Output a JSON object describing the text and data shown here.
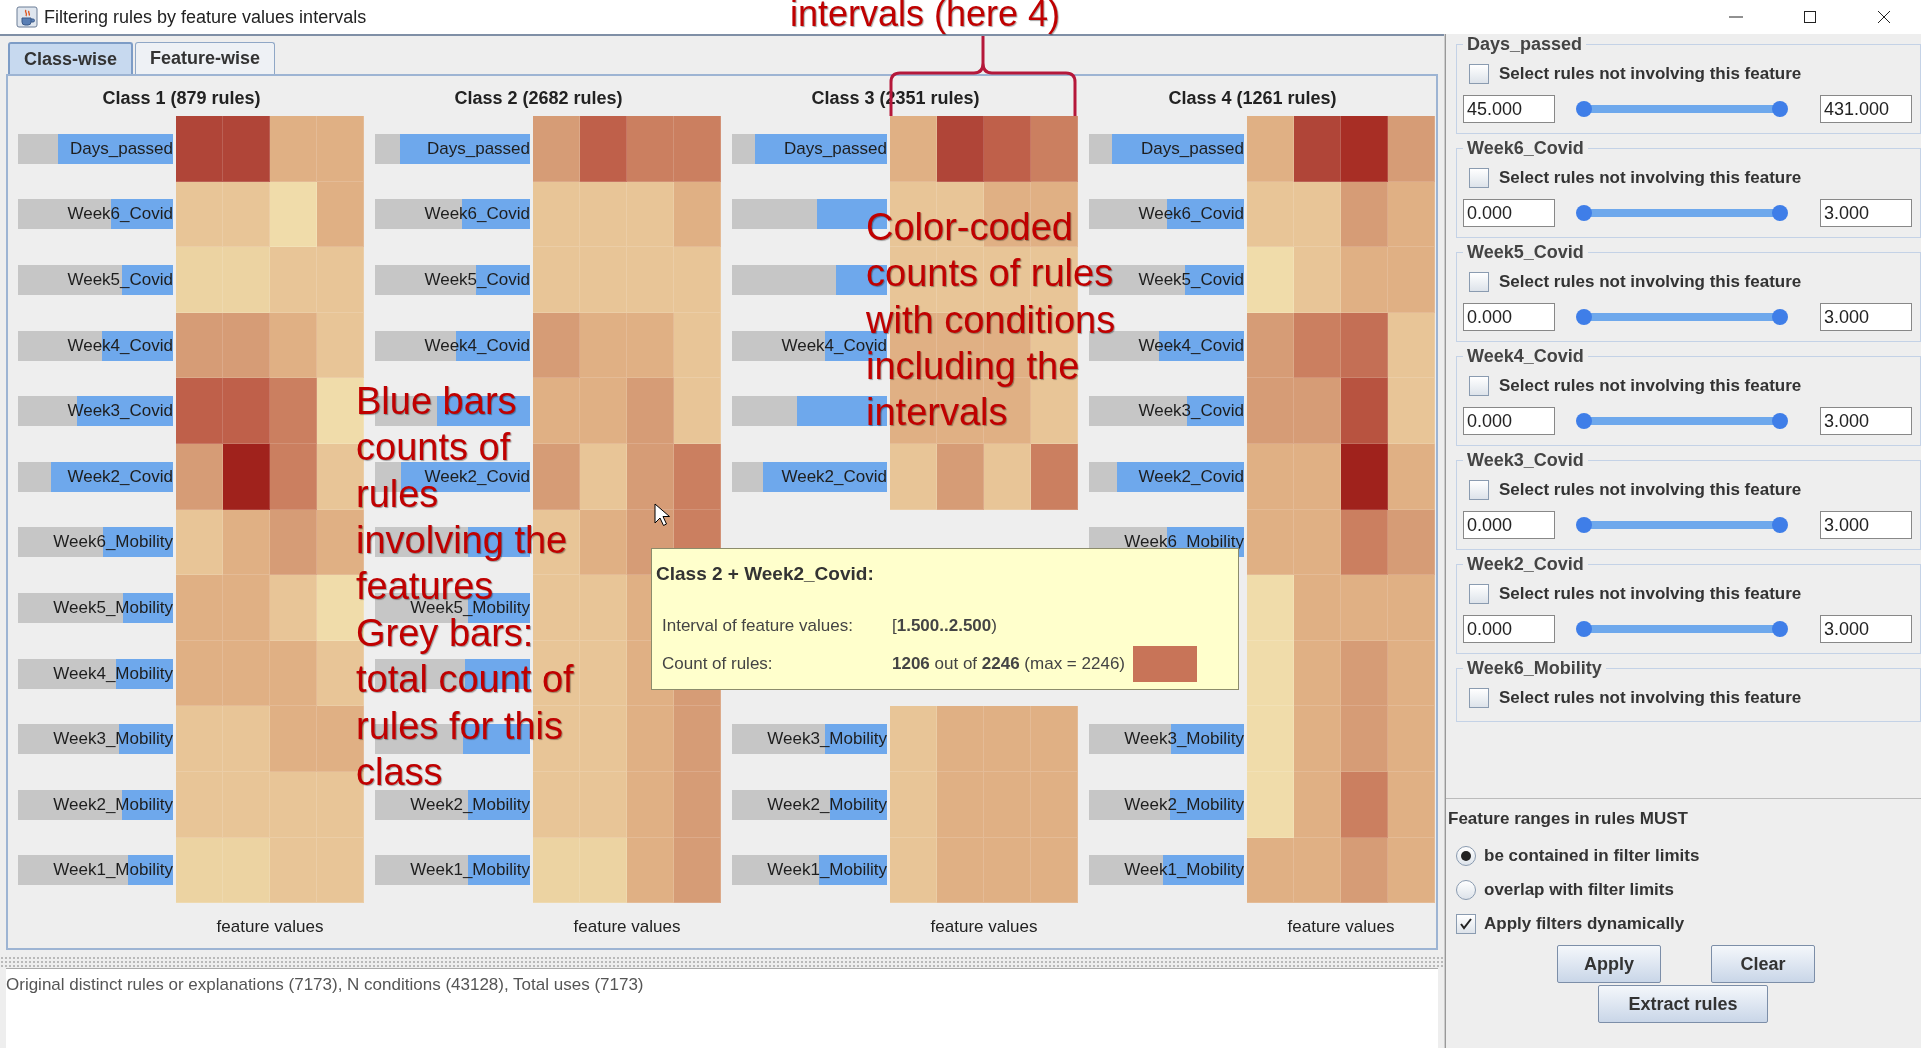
{
  "window": {
    "title": "Filtering rules by feature values intervals"
  },
  "tabs": [
    {
      "label": "Class-wise",
      "selected": true
    },
    {
      "label": "Feature-wise",
      "selected": false
    }
  ],
  "classes": [
    {
      "title": "Class 1 (879 rules)",
      "axis_label": "feature values",
      "rows": [
        {
          "label": "Days_passed",
          "level": 0.74,
          "cells": [
            {
              "color": "#b04538"
            },
            {
              "color": "#b04538"
            },
            {
              "color": "#e0b084"
            },
            {
              "color": "#e0b084"
            }
          ]
        },
        {
          "label": "Week6_Covid",
          "level": 0.4,
          "cells": [
            {
              "color": "#e8c597"
            },
            {
              "color": "#e8c597"
            },
            {
              "color": "#f0dcaa"
            },
            {
              "color": "#e0b084"
            }
          ]
        },
        {
          "label": "Week5_Covid",
          "level": 0.33,
          "cells": [
            {
              "color": "#ecd3a2"
            },
            {
              "color": "#ecd3a2"
            },
            {
              "color": "#e8c597"
            },
            {
              "color": "#e8c597"
            }
          ]
        },
        {
          "label": "Week4_Covid",
          "level": 0.46,
          "cells": [
            {
              "color": "#d69c76"
            },
            {
              "color": "#d69c76"
            },
            {
              "color": "#e0b084"
            },
            {
              "color": "#e8c597"
            }
          ]
        },
        {
          "label": "Week3_Covid",
          "level": 0.62,
          "cells": [
            {
              "color": "#bf604a"
            },
            {
              "color": "#bf604a"
            },
            {
              "color": "#cb7f60"
            },
            {
              "color": "#f0dcaa"
            }
          ]
        },
        {
          "label": "Week2_Covid",
          "level": 0.79,
          "cells": [
            {
              "color": "#d69c76"
            },
            {
              "color": "#a0221c"
            },
            {
              "color": "#cb7f60"
            },
            {
              "color": "#e8c597"
            }
          ]
        },
        {
          "label": "Week6_Mobility",
          "level": 0.45,
          "cells": [
            {
              "color": "#e8c597"
            },
            {
              "color": "#e0b084"
            },
            {
              "color": "#d69c76"
            },
            {
              "color": "#e0b084"
            }
          ]
        },
        {
          "label": "Week5_Mobility",
          "level": 0.32,
          "cells": [
            {
              "color": "#e0b084"
            },
            {
              "color": "#e0b084"
            },
            {
              "color": "#e8c597"
            },
            {
              "color": "#f0dcaa"
            }
          ]
        },
        {
          "label": "Week4_Mobility",
          "level": 0.37,
          "cells": [
            {
              "color": "#e0b084"
            },
            {
              "color": "#e0b084"
            },
            {
              "color": "#e0b084"
            },
            {
              "color": "#e8c597"
            }
          ]
        },
        {
          "label": "Week3_Mobility",
          "level": 0.35,
          "cells": [
            {
              "color": "#e8c597"
            },
            {
              "color": "#e8c597"
            },
            {
              "color": "#e0b084"
            },
            {
              "color": "#e0b084"
            }
          ]
        },
        {
          "label": "Week2_Mobility",
          "level": 0.33,
          "cells": [
            {
              "color": "#e8c597"
            },
            {
              "color": "#e8c597"
            },
            {
              "color": "#e8c597"
            },
            {
              "color": "#e8c597"
            }
          ]
        },
        {
          "label": "Week1_Mobility",
          "level": 0.29,
          "cells": [
            {
              "color": "#ecd3a2"
            },
            {
              "color": "#ecd3a2"
            },
            {
              "color": "#e8c597"
            },
            {
              "color": "#e8c597"
            }
          ]
        }
      ]
    },
    {
      "title": "Class 2 (2682 rules)",
      "axis_label": "feature values",
      "rows": [
        {
          "label": "Days_passed",
          "level": 0.84,
          "cells": [
            {
              "color": "#d69c76"
            },
            {
              "color": "#bf604a"
            },
            {
              "color": "#cb7f60"
            },
            {
              "color": "#cb7f60"
            }
          ]
        },
        {
          "label": "Week6_Covid",
          "level": 0.44,
          "cells": [
            {
              "color": "#e8c597"
            },
            {
              "color": "#e8c597"
            },
            {
              "color": "#e8c597"
            },
            {
              "color": "#e0b084"
            }
          ]
        },
        {
          "label": "Week5_Covid",
          "level": 0.35,
          "cells": [
            {
              "color": "#e8c597"
            },
            {
              "color": "#e8c597"
            },
            {
              "color": "#e8c597"
            },
            {
              "color": "#e8c597"
            }
          ]
        },
        {
          "label": "Week4_Covid",
          "level": 0.48,
          "cells": [
            {
              "color": "#d69c76"
            },
            {
              "color": "#e0b084"
            },
            {
              "color": "#e0b084"
            },
            {
              "color": "#e8c597"
            }
          ]
        },
        {
          "level": 0.6,
          "cells": [
            {
              "color": "#e0b084"
            },
            {
              "color": "#e0b084"
            },
            {
              "color": "#d69c76"
            },
            {
              "color": "#e8c597"
            }
          ]
        },
        {
          "label": "Week2_Covid",
          "level": 0.83,
          "cells": [
            {
              "color": "#d69c76"
            },
            {
              "color": "#e8c597"
            },
            {
              "color": "#d69c76"
            },
            {
              "color": "#cb7f60"
            }
          ]
        },
        {
          "level": 0.4,
          "cells": [
            {
              "color": "#e8c597"
            },
            {
              "color": "#e0b084"
            },
            {
              "color": "#d69c76"
            },
            {
              "color": "#cb7f60"
            }
          ]
        },
        {
          "label": "Week5_Mobility",
          "level": 0.4,
          "cells": [
            {
              "color": "#e8c597"
            },
            {
              "color": "#e8c597"
            },
            {
              "color": "#e0b084"
            },
            {}
          ]
        },
        {
          "level": 0.42,
          "cells": [
            {
              "color": "#e8c597"
            },
            {
              "color": "#e8c597"
            },
            {
              "color": "#e0b084"
            },
            {
              "color": "#d69c76"
            }
          ]
        },
        {
          "level": 0.43,
          "cells": [
            {
              "color": "#e8c597"
            },
            {
              "color": "#e8c597"
            },
            {
              "color": "#e0b084"
            },
            {
              "color": "#d69c76"
            }
          ]
        },
        {
          "label": "Week2_Mobility",
          "level": 0.4,
          "cells": [
            {
              "color": "#e8c597"
            },
            {
              "color": "#e8c597"
            },
            {
              "color": "#e0b084"
            },
            {
              "color": "#d69c76"
            }
          ]
        },
        {
          "label": "Week1_Mobility",
          "level": 0.4,
          "cells": [
            {
              "color": "#ecd3a2"
            },
            {
              "color": "#ecd3a2"
            },
            {
              "color": "#e0b084"
            },
            {
              "color": "#d69c76"
            }
          ]
        }
      ]
    },
    {
      "title": "Class 3 (2351 rules)",
      "axis_label": "feature values",
      "rows": [
        {
          "label": "Days_passed",
          "level": 0.85,
          "cells": [
            {
              "color": "#e0b084"
            },
            {
              "color": "#b04538"
            },
            {
              "color": "#bf604a"
            },
            {
              "color": "#cb7f60"
            }
          ]
        },
        {
          "level": 0.45,
          "cells": [
            {
              "color": "#e8c597"
            },
            {
              "color": "#e8c597"
            },
            {
              "color": "#e0b084"
            },
            {
              "color": "#e0b084"
            }
          ]
        },
        {
          "level": 0.33,
          "cells": [
            {
              "color": "#e8c597"
            },
            {
              "color": "#e8c597"
            },
            {
              "color": "#e8c597"
            },
            {
              "color": "#e8c597"
            }
          ]
        },
        {
          "label": "Week4_Covid",
          "level": 0.4,
          "cells": [
            {
              "color": "#e0b084"
            },
            {
              "color": "#e0b084"
            },
            {
              "color": "#e0b084"
            },
            {
              "color": "#e8c597"
            }
          ]
        },
        {
          "level": 0.58,
          "cells": [
            {
              "color": "#e0b084"
            },
            {
              "color": "#e0b084"
            },
            {
              "color": "#e0b084"
            },
            {
              "color": "#e8c597"
            }
          ]
        },
        {
          "label": "Week2_Covid",
          "level": 0.8,
          "cells": [
            {
              "color": "#e8c597"
            },
            {
              "color": "#d69c76"
            },
            {
              "color": "#e8c597"
            },
            {
              "color": "#cb7f60"
            }
          ]
        },
        {
          "cells": []
        },
        {
          "cells": []
        },
        {
          "cells": []
        },
        {
          "label": "Week3_Mobility",
          "level": 0.4,
          "cells": [
            {
              "color": "#e8c597"
            },
            {
              "color": "#e0b084"
            },
            {
              "color": "#e0b084"
            },
            {
              "color": "#e0b084"
            }
          ]
        },
        {
          "label": "Week2_Mobility",
          "level": 0.37,
          "cells": [
            {
              "color": "#e8c597"
            },
            {
              "color": "#e0b084"
            },
            {
              "color": "#e0b084"
            },
            {
              "color": "#e0b084"
            }
          ]
        },
        {
          "label": "Week1_Mobility",
          "level": 0.44,
          "cells": [
            {
              "color": "#e8c597"
            },
            {
              "color": "#e0b084"
            },
            {
              "color": "#e0b084"
            },
            {
              "color": "#e0b084"
            }
          ]
        }
      ]
    },
    {
      "title": "Class 4 (1261 rules)",
      "axis_label": "feature values",
      "rows": [
        {
          "label": "Days_passed",
          "level": 0.85,
          "cells": [
            {
              "color": "#e0b084"
            },
            {
              "color": "#b04538"
            },
            {
              "color": "#a82e25"
            },
            {
              "color": "#d69c76"
            }
          ]
        },
        {
          "label": "Week6_Covid",
          "level": 0.5,
          "cells": [
            {
              "color": "#e8c597"
            },
            {
              "color": "#e8c597"
            },
            {
              "color": "#d69c76"
            },
            {
              "color": "#e0b084"
            }
          ]
        },
        {
          "label": "Week5_Covid",
          "level": 0.38,
          "cells": [
            {
              "color": "#f0dcaa"
            },
            {
              "color": "#e8c597"
            },
            {
              "color": "#e0b084"
            },
            {
              "color": "#e0b084"
            }
          ]
        },
        {
          "label": "Week4_Covid",
          "level": 0.55,
          "cells": [
            {
              "color": "#d69c76"
            },
            {
              "color": "#cb7f60"
            },
            {
              "color": "#c46f55"
            },
            {
              "color": "#e8c597"
            }
          ]
        },
        {
          "label": "Week3_Covid",
          "level": 0.37,
          "cells": [
            {
              "color": "#d69c76"
            },
            {
              "color": "#d69c76"
            },
            {
              "color": "#b85340"
            },
            {
              "color": "#e8c597"
            }
          ]
        },
        {
          "label": "Week2_Covid",
          "level": 0.82,
          "cells": [
            {
              "color": "#e0b084"
            },
            {
              "color": "#e0b084"
            },
            {
              "color": "#a0221c"
            },
            {
              "color": "#e0b084"
            }
          ]
        },
        {
          "label": "Week6_Mobility",
          "level": 0.5,
          "cells": [
            {
              "color": "#e0b084"
            },
            {
              "color": "#e0b084"
            },
            {
              "color": "#cb7f60"
            },
            {
              "color": "#d69c76"
            }
          ]
        },
        {
          "cells": [
            {
              "color": "#f0dcaa"
            },
            {
              "color": "#e0b084"
            },
            {
              "color": "#e0b084"
            },
            {
              "color": "#e0b084"
            }
          ]
        },
        {
          "cells": [
            {
              "color": "#f0dcaa"
            },
            {
              "color": "#e0b084"
            },
            {
              "color": "#d69c76"
            },
            {
              "color": "#e0b084"
            }
          ]
        },
        {
          "label": "Week3_Mobility",
          "level": 0.47,
          "cells": [
            {
              "color": "#f0dcaa"
            },
            {
              "color": "#e0b084"
            },
            {
              "color": "#d69c76"
            },
            {
              "color": "#e0b084"
            }
          ]
        },
        {
          "label": "Week2_Mobility",
          "level": 0.48,
          "cells": [
            {
              "color": "#f0dcaa"
            },
            {
              "color": "#e0b084"
            },
            {
              "color": "#cb7f60"
            },
            {
              "color": "#e0b084"
            }
          ]
        },
        {
          "label": "Week1_Mobility",
          "level": 0.52,
          "cells": [
            {
              "color": "#e0b084"
            },
            {
              "color": "#e0b084"
            },
            {
              "color": "#d69c76"
            },
            {
              "color": "#e0b084"
            }
          ]
        }
      ]
    }
  ],
  "tooltip": {
    "title": "Class 2 + Week2_Covid:",
    "interval_label": "Interval of feature values:",
    "interval": "[**1.500..2.500**)",
    "count_label": "Count of rules:",
    "count": "**1206** out of **2246** (max = 2246)",
    "color": "#c87458"
  },
  "status_bar": "Original distinct rules or explanations (7173), N conditions (43128), Total uses (7173)",
  "filters": [
    {
      "feature": "Days_passed",
      "checkbox_label": "Select rules not involving this feature",
      "checked": false,
      "low": "45.000",
      "high": "431.000",
      "thumbs": [
        {
          "level": 0
        },
        {
          "level": 1
        }
      ]
    },
    {
      "feature": "Week6_Covid",
      "checkbox_label": "Select rules not involving this feature",
      "checked": false,
      "low": "0.000",
      "high": "3.000",
      "thumbs": [
        {
          "level": 0
        },
        {
          "level": 1
        }
      ]
    },
    {
      "feature": "Week5_Covid",
      "checkbox_label": "Select rules not involving this feature",
      "checked": false,
      "low": "0.000",
      "high": "3.000",
      "thumbs": [
        {
          "level": 0
        },
        {
          "level": 1
        }
      ]
    },
    {
      "feature": "Week4_Covid",
      "checkbox_label": "Select rules not involving this feature",
      "checked": false,
      "low": "0.000",
      "high": "3.000",
      "thumbs": [
        {
          "level": 0
        },
        {
          "level": 1
        }
      ]
    },
    {
      "feature": "Week3_Covid",
      "checkbox_label": "Select rules not involving this feature",
      "checked": false,
      "low": "0.000",
      "high": "3.000",
      "thumbs": [
        {
          "level": 0
        },
        {
          "level": 1
        }
      ]
    },
    {
      "feature": "Week2_Covid",
      "checkbox_label": "Select rules not involving this feature",
      "checked": false,
      "low": "0.000",
      "high": "3.000",
      "thumbs": [
        {
          "level": 0
        },
        {
          "level": 1
        }
      ]
    },
    {
      "feature": "Week6_Mobility",
      "checkbox_label": "Select rules not involving this feature",
      "checked": false
    }
  ],
  "range_mode": {
    "label": "Feature ranges in rules MUST",
    "options": [
      {
        "label": "be contained in filter limits",
        "selected": true
      },
      {
        "label": "overlap with filter limits",
        "selected": false
      }
    ]
  },
  "apply_dynamic": {
    "label": "Apply filters dynamically",
    "checked": true
  },
  "buttons": [
    {
      "label": "Apply"
    },
    {
      "label": "Clear"
    },
    {
      "label": "Extract rules"
    }
  ],
  "annotations": [
    {
      "kind": "brace",
      "paragraphs": [
        "intervals (here 4)"
      ]
    },
    {
      "kind": "panel",
      "paragraphs": [
        "Blue bars",
        "counts of",
        "rules",
        "involving the",
        "features",
        "Grey bars:",
        "total count of",
        "rules for this",
        "class"
      ]
    },
    {
      "kind": "panel",
      "paragraphs": [
        "Color-coded",
        "counts of rules",
        "with conditions",
        "including the",
        "intervals"
      ]
    }
  ]
}
